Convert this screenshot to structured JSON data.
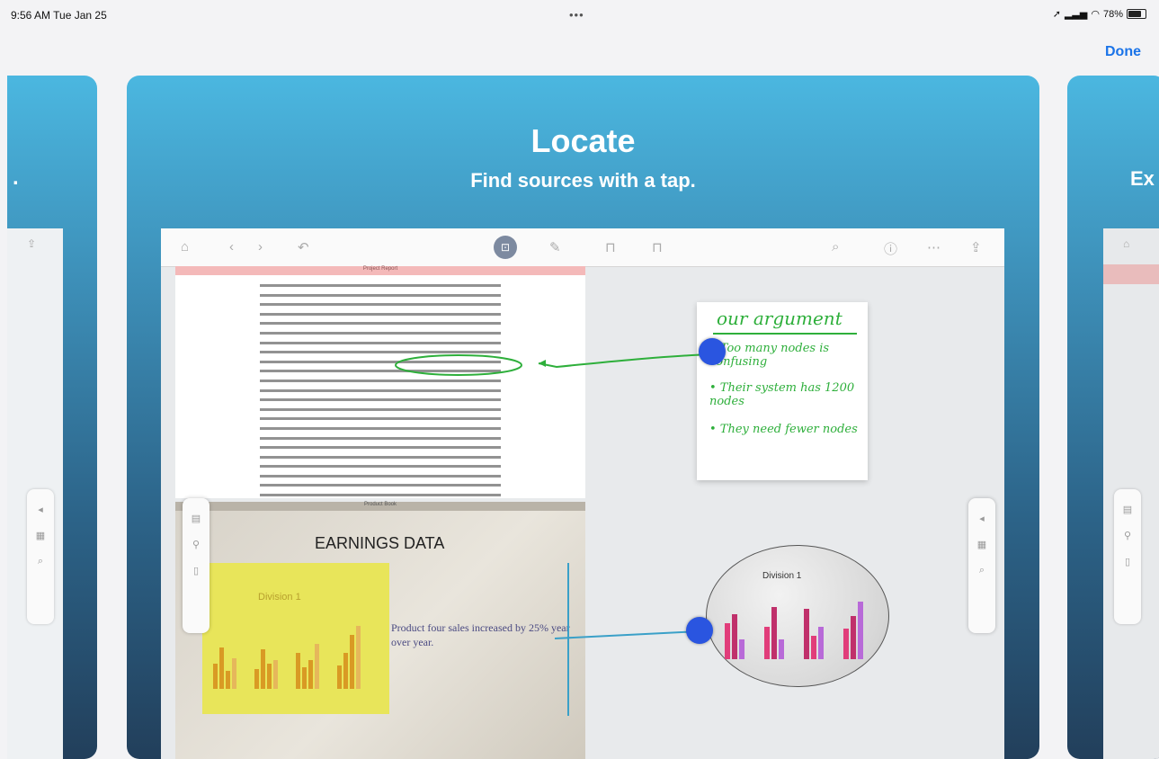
{
  "status_bar": {
    "time": "9:56 AM  Tue Jan 25",
    "dots": "•••",
    "battery": "78%",
    "battery_level": 0.78
  },
  "nav": {
    "done_label": "Done"
  },
  "carousel": {
    "left_peek_text": ".",
    "right_peek_text": "Ex",
    "main": {
      "title": "Locate",
      "subtitle": "Find sources with a tap."
    }
  },
  "app": {
    "doc1_header": "Project Report",
    "doc2_header": "Product Book",
    "earnings_title": "EARNINGS DATA",
    "yellow_division": "Division 1",
    "earnings_text": "Product four sales increased by 25% year over year.",
    "note": {
      "title": "our argument",
      "line1": "• Too many nodes is confusing",
      "line2": "• Their system has 1200 nodes",
      "line3": "• They need fewer nodes"
    },
    "blob_division": "Division 1"
  },
  "colors": {
    "accent": "#1a73e8",
    "card_top": "#4bb7e0",
    "card_bottom": "#223f5b",
    "link_green": "#2eaf3b",
    "link_teal": "#3aa0c8",
    "dot_blue": "#2a55e0"
  }
}
